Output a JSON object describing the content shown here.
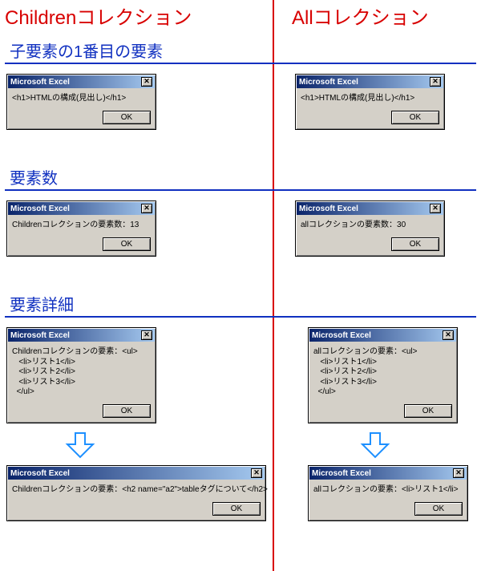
{
  "headers": {
    "left": "Childrenコレクション",
    "right": "Allコレクション"
  },
  "sections": {
    "s1": "子要素の1番目の要素",
    "s2": "要素数",
    "s3": "要素詳細"
  },
  "dialogTitle": "Microsoft Excel",
  "okLabel": "OK",
  "closeGlyph": "✕",
  "msgs": {
    "l1": "<h1>HTMLの構成(見出し)</h1>",
    "r1": "<h1>HTMLの構成(見出し)</h1>",
    "l2": "Childrenコレクションの要素数：13",
    "r2": "allコレクションの要素数：30",
    "l3": "Childrenコレクションの要素：<ul>\n   <li>リスト1</li>\n   <li>リスト2</li>\n   <li>リスト3</li>\n  </ul>",
    "r3": "allコレクションの要素：<ul>\n   <li>リスト1</li>\n   <li>リスト2</li>\n   <li>リスト3</li>\n  </ul>",
    "l4": "Childrenコレクションの要素：<h2 name=\"a2\">tableタグについて</h2>",
    "r4": "allコレクションの要素：<li>リスト1</li>"
  }
}
